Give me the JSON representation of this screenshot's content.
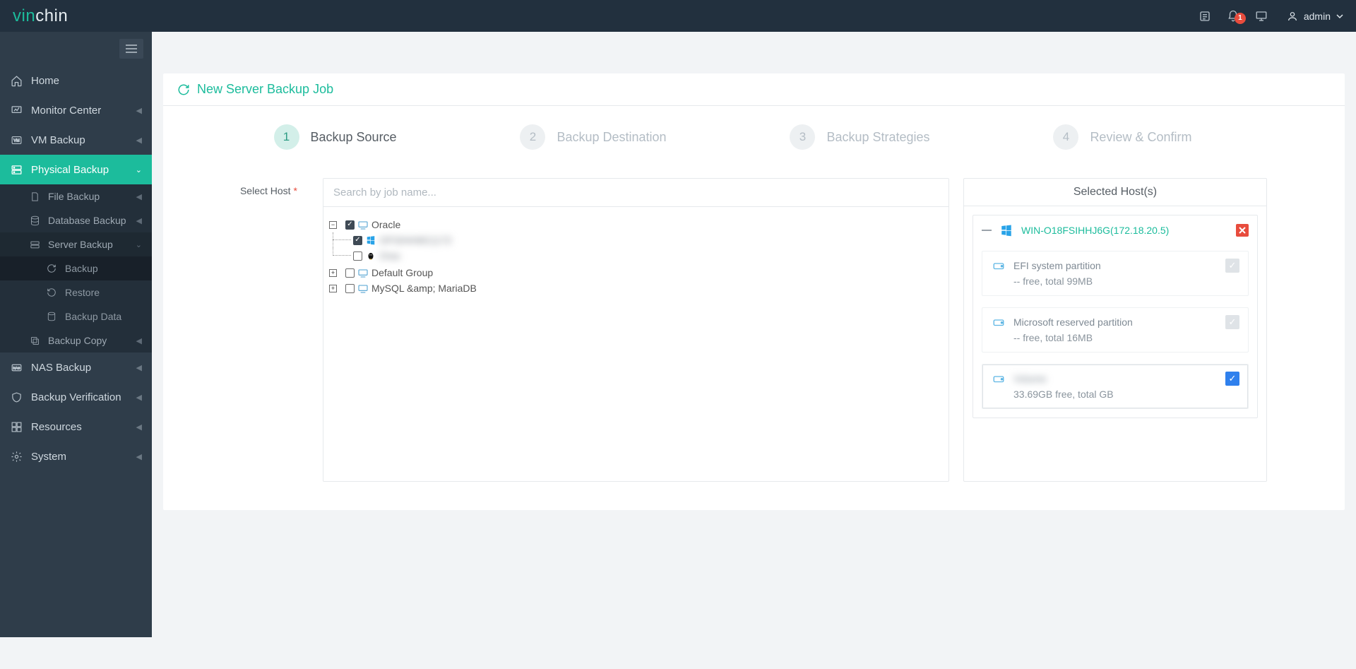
{
  "header": {
    "notif_count": "1",
    "user_label": "admin"
  },
  "sidebar": {
    "home": "Home",
    "monitor": "Monitor Center",
    "vmbackup": "VM Backup",
    "physical": "Physical Backup",
    "file": "File Backup",
    "database": "Database Backup",
    "server": "Server Backup",
    "backup": "Backup",
    "restore": "Restore",
    "backup_data": "Backup Data",
    "backup_copy": "Backup Copy",
    "nas": "NAS Backup",
    "verify": "Backup Verification",
    "resources": "Resources",
    "system": "System"
  },
  "page": {
    "title": "New Server Backup Job",
    "steps": {
      "s1": {
        "num": "1",
        "label": "Backup Source"
      },
      "s2": {
        "num": "2",
        "label": "Backup Destination"
      },
      "s3": {
        "num": "3",
        "label": "Backup Strategies"
      },
      "s4": {
        "num": "4",
        "label": "Review & Confirm"
      }
    },
    "field_label": "Select Host",
    "search_placeholder": "Search by job name...",
    "tree": {
      "grp1": "Oracle",
      "child1": "OFSIHHI6C(172",
      "child2": "Orac",
      "grp2": "Default Group",
      "grp3": "MySQL &amp; MariaDB"
    },
    "selected_title": "Selected Host(s)",
    "selected_host": "WIN-O18FSIHHJ6G(172.18.20.5)",
    "parts": {
      "p1": {
        "name": "EFI system partition",
        "detail": "-- free, total 99MB"
      },
      "p2": {
        "name": "Microsoft reserved partition",
        "detail": "-- free, total 16MB"
      },
      "p3": {
        "name": "Volume",
        "detail": "33.69GB free, total  GB"
      }
    }
  }
}
